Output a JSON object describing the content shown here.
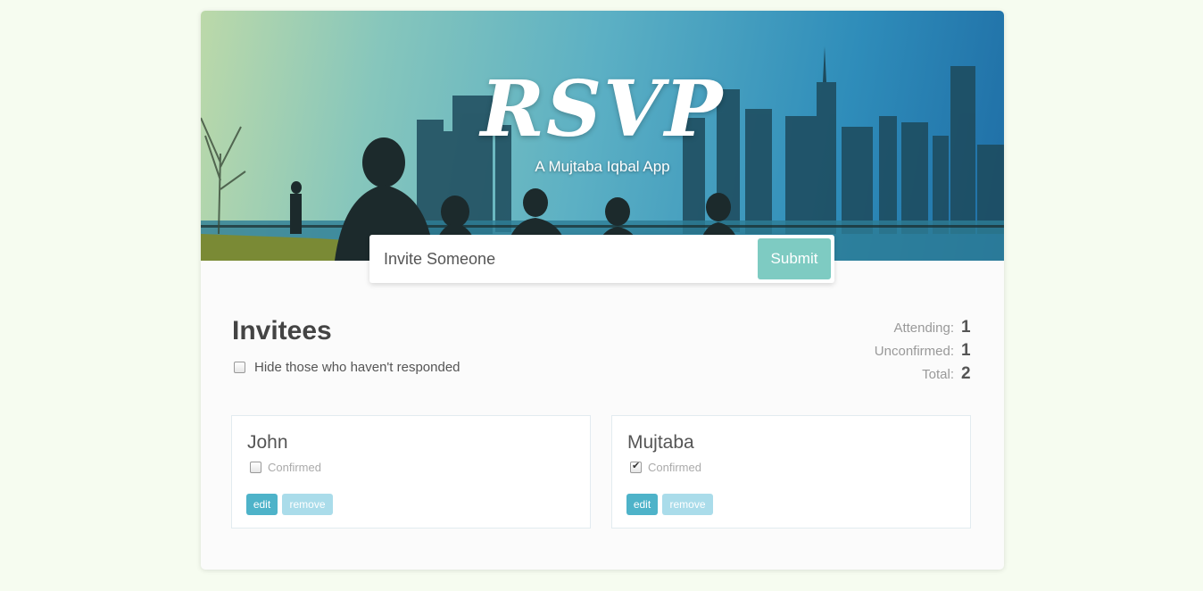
{
  "header": {
    "title": "RSVP",
    "subtitle": "A Mujtaba Iqbal App"
  },
  "invite_form": {
    "placeholder": "Invite Someone",
    "submit_label": "Submit"
  },
  "invitees": {
    "heading": "Invitees",
    "filter_label": "Hide those who haven't responded",
    "filter_checked": false
  },
  "stats": {
    "attending_label": "Attending:",
    "attending_value": "1",
    "unconfirmed_label": "Unconfirmed:",
    "unconfirmed_value": "1",
    "total_label": "Total:",
    "total_value": "2"
  },
  "guests": [
    {
      "name": "John",
      "confirmed_label": "Confirmed",
      "confirmed": false,
      "edit_label": "edit",
      "remove_label": "remove"
    },
    {
      "name": "Mujtaba",
      "confirmed_label": "Confirmed",
      "confirmed": true,
      "edit_label": "edit",
      "remove_label": "remove"
    }
  ],
  "colors": {
    "page_background": "#f6fcf0",
    "submit_button": "#7ecbc2",
    "edit_button": "#4eb3c9",
    "remove_button": "#aadcea"
  }
}
